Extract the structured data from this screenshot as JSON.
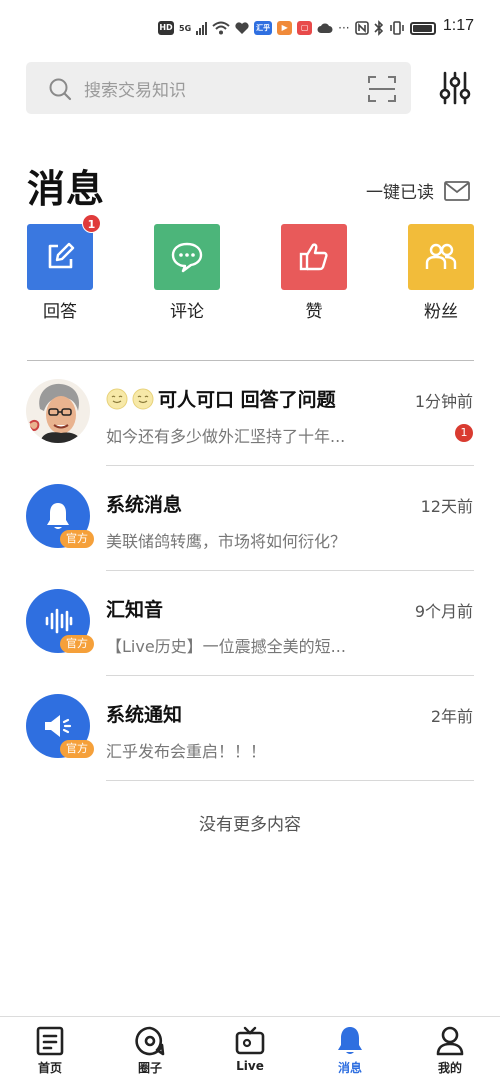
{
  "status_bar": {
    "network_hd": "HD",
    "network_5g": "5G",
    "app_badge": "汇乎",
    "overflow": "···",
    "time": "1:17"
  },
  "search": {
    "placeholder": "搜索交易知识"
  },
  "header": {
    "title": "消息",
    "mark_all_read": "一键已读"
  },
  "categories": [
    {
      "label": "回答",
      "color": "#3a78e0",
      "icon": "edit-icon",
      "badge": "1"
    },
    {
      "label": "评论",
      "color": "#4cb57a",
      "icon": "comment-icon",
      "badge": ""
    },
    {
      "label": "赞",
      "color": "#e85a5a",
      "icon": "thumbs-up-icon",
      "badge": ""
    },
    {
      "label": "粉丝",
      "color": "#f2bc3a",
      "icon": "fans-icon",
      "badge": ""
    }
  ],
  "messages": [
    {
      "title": "可人可口 回答了问题",
      "time": "1分钟前",
      "preview": "如今还有多少做外汇坚持了十年...",
      "badge": "1",
      "avatar": "user-avatar"
    },
    {
      "title": "系统消息",
      "time": "12天前",
      "preview": "美联储鸽转鹰，市场将如何衍化？",
      "tag": "官方",
      "avatar": "bell-icon"
    },
    {
      "title": "汇知音",
      "time": "9个月前",
      "preview": "【Live历史】一位震撼全美的短...",
      "tag": "官方",
      "avatar": "audio-wave-icon"
    },
    {
      "title": "系统通知",
      "time": "2年前",
      "preview": "汇乎发布会重启！！！",
      "tag": "官方",
      "avatar": "megaphone-icon"
    }
  ],
  "end_text": "没有更多内容",
  "bottom_nav": [
    {
      "label": "首页",
      "icon": "home-doc-icon"
    },
    {
      "label": "圈子",
      "icon": "circle-icon"
    },
    {
      "label": "Live",
      "icon": "tv-icon"
    },
    {
      "label": "消息",
      "icon": "bell-icon",
      "active": true
    },
    {
      "label": "我的",
      "icon": "person-icon"
    }
  ],
  "colors": {
    "accent": "#2f6fe0",
    "badge": "#e03b3b",
    "official_tag": "#f5a03a"
  }
}
